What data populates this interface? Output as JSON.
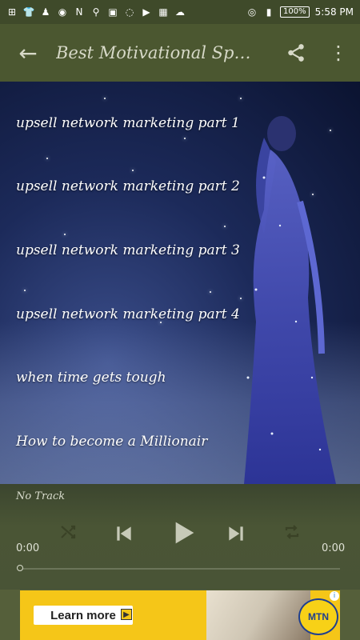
{
  "status_bar": {
    "battery": "100%",
    "time": "5:58 PM",
    "icons": [
      "add-box-icon",
      "tshirt-icon",
      "person-icon",
      "radio-icon",
      "notification-n-icon",
      "broom-icon",
      "image-icon",
      "chat-icon",
      "youtube-icon",
      "app-icon",
      "weather-icon",
      "hotspot-icon",
      "signal-icon",
      "battery-icon"
    ]
  },
  "app_bar": {
    "title": "Best Motivational Spee...",
    "back_icon": "arrow-left-icon",
    "share_icon": "share-icon",
    "more_icon": "more-vert-icon"
  },
  "tracks": [
    {
      "label": "upsell network marketing part 1"
    },
    {
      "label": "upsell network marketing part 2"
    },
    {
      "label": "upsell network marketing part 3"
    },
    {
      "label": "upsell network marketing part 4"
    },
    {
      "label": "when time gets tough"
    },
    {
      "label": "How to become a Millionair"
    }
  ],
  "player": {
    "track_name": "No Track",
    "elapsed": "0:00",
    "duration": "0:00",
    "progress": 0
  },
  "ad": {
    "button_label": "Learn more",
    "brand": "MTN"
  }
}
